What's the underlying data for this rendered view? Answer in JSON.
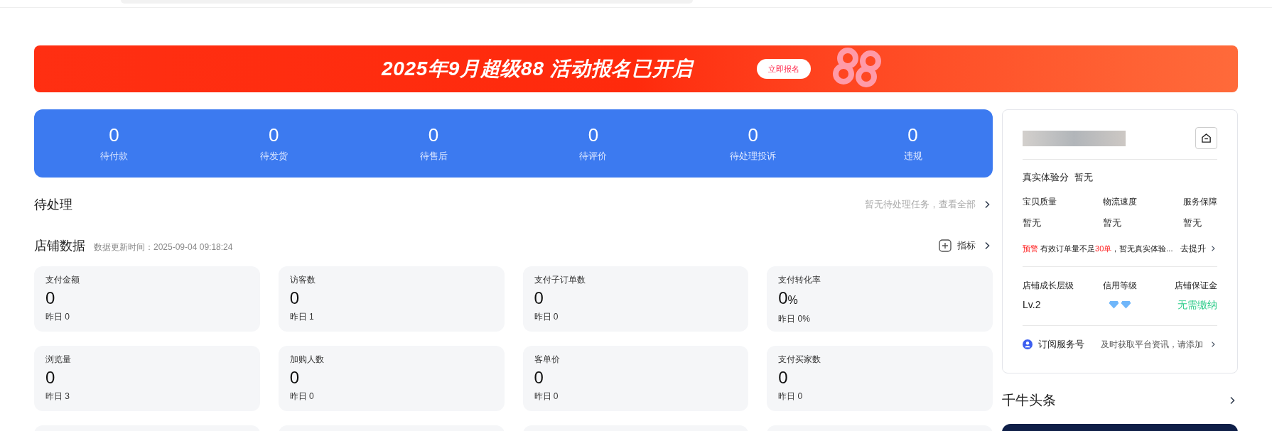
{
  "banner": {
    "title": "2025年9月超级88 活动报名已开启",
    "button": "立即报名"
  },
  "order_stats": [
    {
      "value": "0",
      "label": "待付款"
    },
    {
      "value": "0",
      "label": "待发货"
    },
    {
      "value": "0",
      "label": "待售后"
    },
    {
      "value": "0",
      "label": "待评价"
    },
    {
      "value": "0",
      "label": "待处理投诉"
    },
    {
      "value": "0",
      "label": "违规"
    }
  ],
  "todo": {
    "title": "待处理",
    "link": "暂无待处理任务，查看全部"
  },
  "store_data": {
    "title": "店铺数据",
    "updated": "数据更新时间：2025-09-04 09:18:24",
    "metrics_button": "指标",
    "cards": [
      {
        "label": "支付金额",
        "value": "0",
        "yesterday": "昨日 0"
      },
      {
        "label": "访客数",
        "value": "0",
        "yesterday": "昨日 1"
      },
      {
        "label": "支付子订单数",
        "value": "0",
        "yesterday": "昨日 0"
      },
      {
        "label": "支付转化率",
        "value": "0",
        "unit": "%",
        "yesterday": "昨日 0%"
      },
      {
        "label": "浏览量",
        "value": "0",
        "yesterday": "昨日 3"
      },
      {
        "label": "加购人数",
        "value": "0",
        "yesterday": "昨日 0"
      },
      {
        "label": "客单价",
        "value": "0",
        "yesterday": "昨日 0"
      },
      {
        "label": "支付买家数",
        "value": "0",
        "yesterday": "昨日 0"
      }
    ]
  },
  "shop_panel": {
    "score_label": "真实体验分",
    "score_value": "暂无",
    "sub_scores": [
      {
        "label": "宝贝质量",
        "value": "暂无"
      },
      {
        "label": "物流速度",
        "value": "暂无"
      },
      {
        "label": "服务保障",
        "value": "暂无"
      }
    ],
    "warning": {
      "tag": "预警",
      "text_before": "有效订单量不足",
      "highlight": "30单",
      "text_after": "，暂无真实体验...",
      "action": "去提升"
    },
    "levels": [
      {
        "kind": "text",
        "label": "店铺成长层级",
        "value": "Lv.2"
      },
      {
        "kind": "diamonds",
        "label": "信用等级",
        "badges": [
          {
            "kind": "diamond"
          },
          {
            "kind": "diamond"
          }
        ]
      },
      {
        "kind": "status",
        "label": "店铺保证金",
        "value": "无需缴纳"
      }
    ],
    "subscribe": {
      "title": "订阅服务号",
      "hint": "及时获取平台资讯，请添加"
    }
  },
  "news": {
    "title": "千牛头条"
  }
}
